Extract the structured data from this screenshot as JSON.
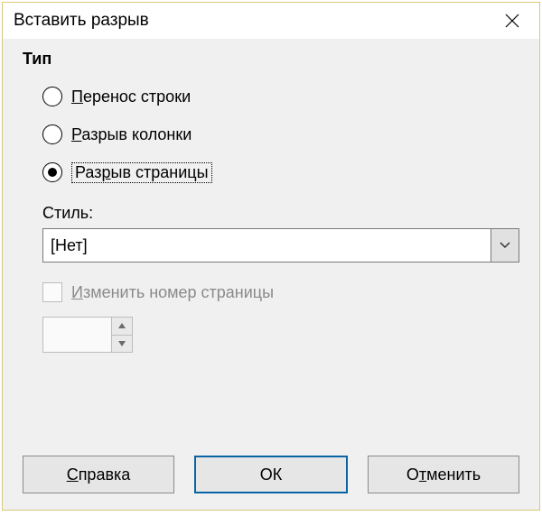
{
  "dialog": {
    "title": "Вставить разрыв"
  },
  "type": {
    "label": "Тип",
    "options": {
      "line_break": {
        "pre": "",
        "accel": "П",
        "post": "еренос строки"
      },
      "column_break": {
        "pre": "",
        "accel": "Р",
        "post": "азрыв колонки"
      },
      "page_break": {
        "pre": "Раз",
        "accel": "р",
        "post": "ыв страницы"
      }
    },
    "selected": "page_break",
    "focused": "page_break"
  },
  "style": {
    "label": "Стиль:",
    "value": "[Нет]"
  },
  "change_page_number": {
    "pre": "",
    "accel": "И",
    "post": "зменить номер страницы",
    "checked": false,
    "enabled": false
  },
  "page_number": {
    "value": "",
    "enabled": false
  },
  "buttons": {
    "help": {
      "pre": "",
      "accel": "С",
      "post": "правка"
    },
    "ok": {
      "label": "ОК"
    },
    "cancel": {
      "pre": "О",
      "accel": "т",
      "post": "менить"
    }
  }
}
